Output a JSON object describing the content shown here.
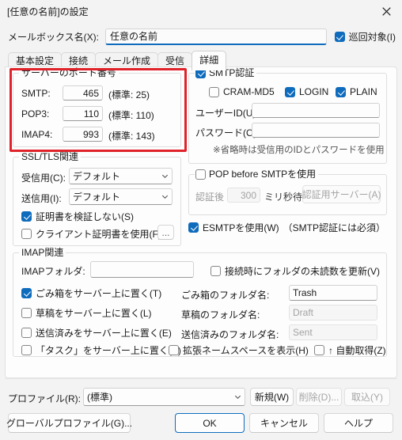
{
  "window": {
    "title": "[任意の名前]の設定",
    "close_icon": "close-icon"
  },
  "mailbox": {
    "label": "メールボックス名(X):",
    "value": "任意の名前",
    "patrol_label": "巡回対象(I)",
    "patrol_checked": true
  },
  "tabs": [
    {
      "label": "基本設定",
      "active": false
    },
    {
      "label": "接続",
      "active": false
    },
    {
      "label": "メール作成",
      "active": false
    },
    {
      "label": "受信",
      "active": false
    },
    {
      "label": "詳細",
      "active": true
    }
  ],
  "ports": {
    "legend": "サーバーのポート番号",
    "highlighted": true,
    "highlight_color": "#e0232b",
    "rows": [
      {
        "label": "SMTP:",
        "value": "465",
        "default": "(標準: 25)"
      },
      {
        "label": "POP3:",
        "value": "110",
        "default": "(標準: 110)"
      },
      {
        "label": "IMAP4:",
        "value": "993",
        "default": "(標準: 143)"
      }
    ]
  },
  "ssl": {
    "legend": "SSL/TLS関連",
    "receive_label": "受信用(C):",
    "receive_value": "デフォルト",
    "send_label": "送信用(I):",
    "send_value": "デフォルト",
    "no_verify_label": "証明書を検証しない(S)",
    "no_verify_checked": true,
    "client_cert_label": "クライアント証明書を使用(F)",
    "client_cert_checked": false,
    "browse_label": "..."
  },
  "smtp_auth": {
    "legend": "SMTP認証",
    "legend_checked": true,
    "methods": [
      {
        "label": "CRAM-MD5",
        "checked": false
      },
      {
        "label": "LOGIN",
        "checked": true
      },
      {
        "label": "PLAIN",
        "checked": true
      }
    ],
    "userid_label": "ユーザーID(U):",
    "userid_value": "",
    "password_label": "パスワード(O):",
    "password_value": "",
    "note": "※省略時は受信用のIDとパスワードを使用"
  },
  "pop_before_smtp": {
    "legend": "POP before SMTPを使用",
    "legend_checked": false,
    "after_auth_label": "認証後",
    "wait_value": "300",
    "wait_unit_label": "ミリ秒待つ",
    "auth_server_button": "認証用サーバー(A)",
    "disabled": true
  },
  "esmtp": {
    "label": "ESMTPを使用(W)",
    "note": "（SMTP認証には必須）",
    "checked": true
  },
  "imap": {
    "legend": "IMAP関連",
    "folder_label": "IMAPフォルダ:",
    "folder_value": "",
    "unread_refresh_label": "接続時にフォルダの未読数を更新(V)",
    "unread_refresh_checked": false,
    "rows": [
      {
        "checkbox_label": "ごみ箱をサーバー上に置く(T)",
        "checked": true,
        "name_label": "ごみ箱のフォルダ名:",
        "name_value": "Trash",
        "name_disabled": false
      },
      {
        "checkbox_label": "草稿をサーバー上に置く(L)",
        "checked": false,
        "name_label": "草稿のフォルダ名:",
        "name_value": "Draft",
        "name_disabled": true
      },
      {
        "checkbox_label": "送信済みをサーバー上に置く(E)",
        "checked": false,
        "name_label": "送信済みのフォルダ名:",
        "name_value": "Sent",
        "name_disabled": true
      }
    ],
    "task_label": "「タスク」をサーバー上に置く(K)",
    "task_checked": false,
    "namespace_label": "拡張ネームスペースを表示(H)",
    "namespace_checked": false,
    "auto_get_label": "↑ 自動取得(Z)",
    "auto_get_checked": false
  },
  "profile": {
    "label": "プロファイル(R):",
    "value": "(標準)",
    "new_button": "新規(W)",
    "delete_button": "削除(D)...",
    "import_button": "取込(Y)",
    "delete_disabled": true,
    "import_disabled": true
  },
  "footer": {
    "global_profile": "グローバルプロファイル(G)...",
    "ok": "OK",
    "cancel": "キャンセル",
    "help": "ヘルプ"
  }
}
